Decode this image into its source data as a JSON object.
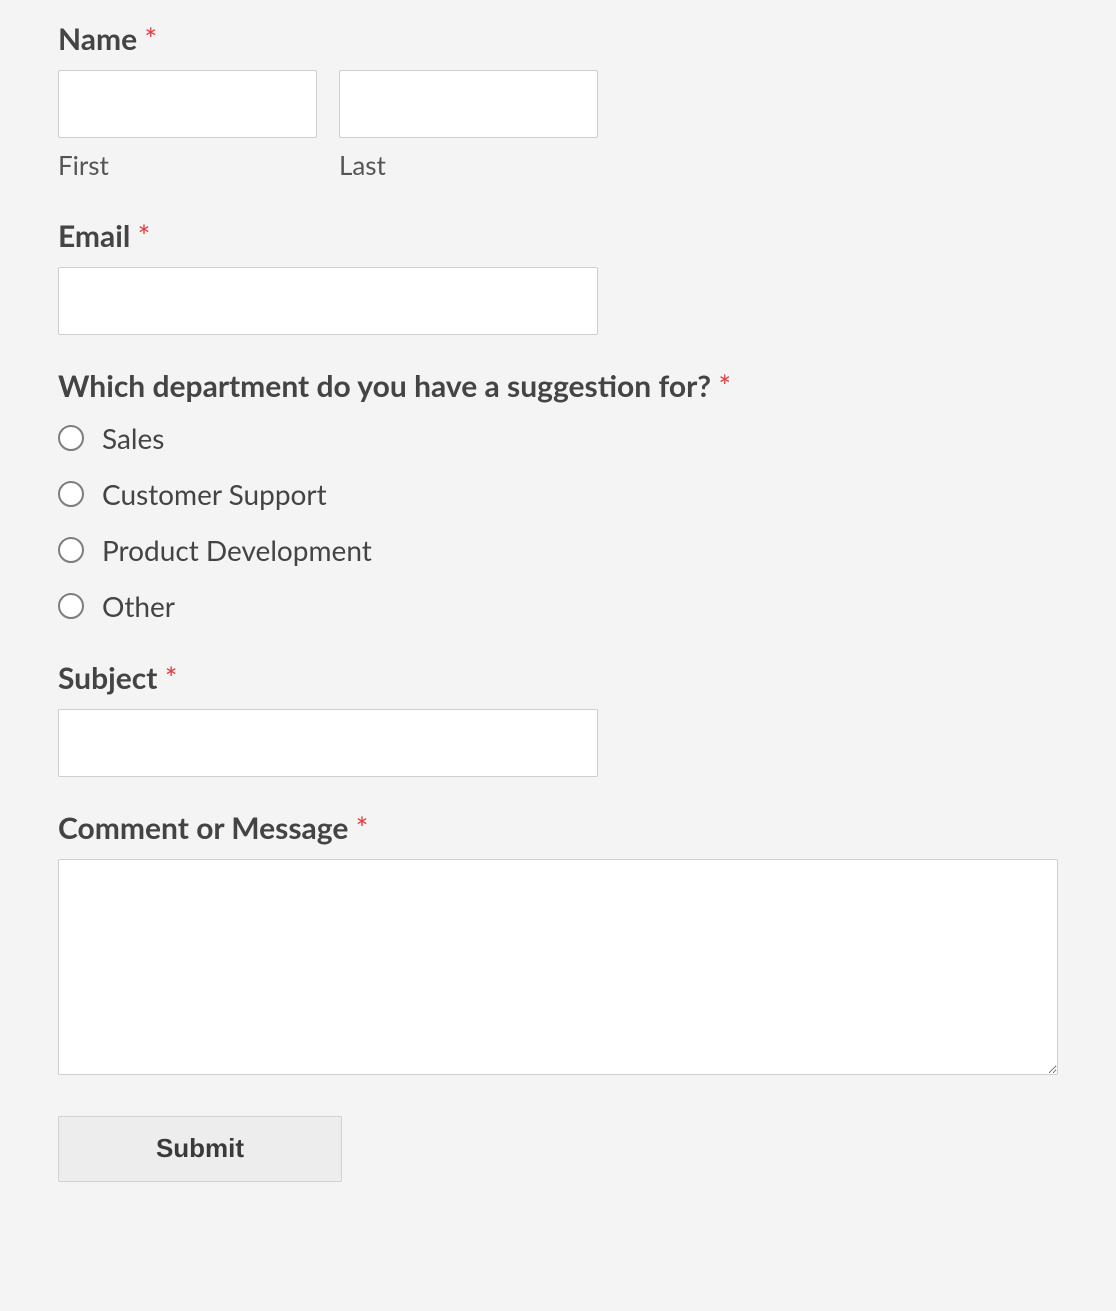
{
  "name": {
    "label": "Name",
    "required": "*",
    "first": {
      "value": "",
      "sublabel": "First"
    },
    "last": {
      "value": "",
      "sublabel": "Last"
    }
  },
  "email": {
    "label": "Email",
    "required": "*",
    "value": ""
  },
  "department": {
    "label": "Which department do you have a suggestion for?",
    "required": "*",
    "options": {
      "0": "Sales",
      "1": "Customer Support",
      "2": "Product Development",
      "3": "Other"
    }
  },
  "subject": {
    "label": "Subject",
    "required": "*",
    "value": ""
  },
  "message": {
    "label": "Comment or Message",
    "required": "*",
    "value": ""
  },
  "submit": {
    "label": "Submit"
  }
}
